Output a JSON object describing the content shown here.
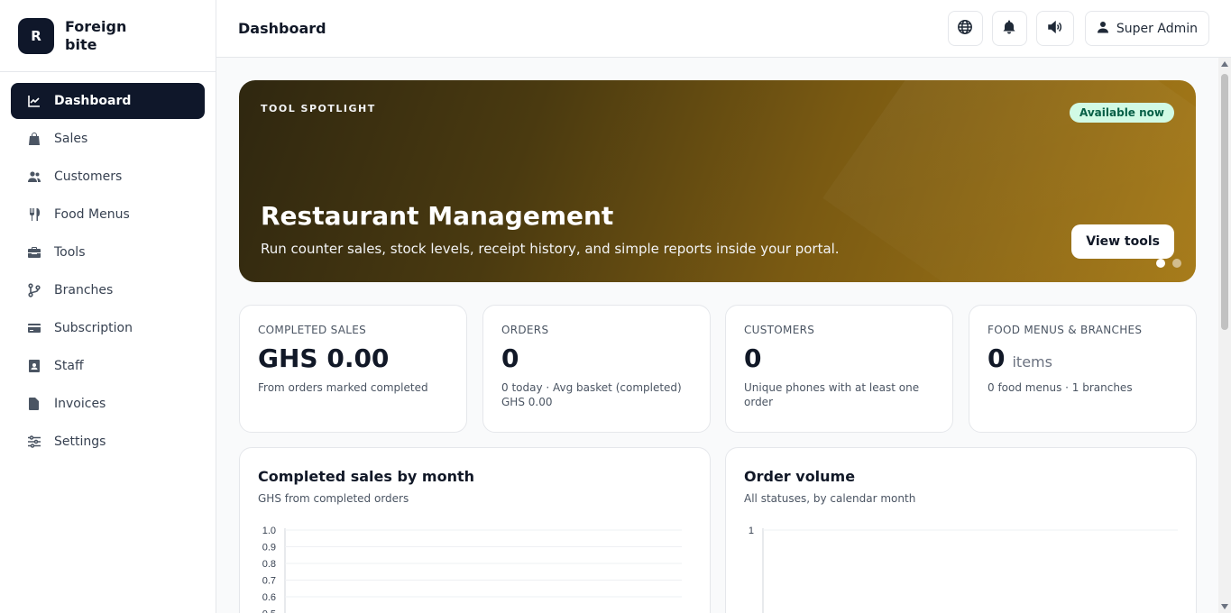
{
  "brand": {
    "logo_letter": "R",
    "name": "Foreign bite"
  },
  "sidebar": {
    "items": [
      {
        "label": "Dashboard",
        "icon": "chart-line-icon",
        "active": true
      },
      {
        "label": "Sales",
        "icon": "shopping-bag-icon",
        "active": false
      },
      {
        "label": "Customers",
        "icon": "users-icon",
        "active": false
      },
      {
        "label": "Food Menus",
        "icon": "utensils-icon",
        "active": false
      },
      {
        "label": "Tools",
        "icon": "toolbox-icon",
        "active": false
      },
      {
        "label": "Branches",
        "icon": "code-branch-icon",
        "active": false
      },
      {
        "label": "Subscription",
        "icon": "credit-card-icon",
        "active": false
      },
      {
        "label": "Staff",
        "icon": "id-badge-icon",
        "active": false
      },
      {
        "label": "Invoices",
        "icon": "file-invoice-icon",
        "active": false
      },
      {
        "label": "Settings",
        "icon": "sliders-icon",
        "active": false
      }
    ]
  },
  "header": {
    "title": "Dashboard",
    "icons": [
      "globe-icon",
      "bell-icon",
      "volume-icon"
    ],
    "user_label": "Super Admin"
  },
  "hero": {
    "kicker": "TOOL SPOTLIGHT",
    "badge": "Available now",
    "title": "Restaurant Management",
    "subtitle": "Run counter sales, stock levels, receipt history, and simple reports inside your portal.",
    "button": "View tools",
    "slides": 2,
    "active_slide": 0
  },
  "stats": [
    {
      "label": "COMPLETED SALES",
      "value": "GHS 0.00",
      "unit": "",
      "note": "From orders marked completed"
    },
    {
      "label": "ORDERS",
      "value": "0",
      "unit": "",
      "note": "0 today · Avg basket (completed) GHS 0.00"
    },
    {
      "label": "CUSTOMERS",
      "value": "0",
      "unit": "",
      "note": "Unique phones with at least one order"
    },
    {
      "label": "FOOD MENUS & BRANCHES",
      "value": "0",
      "unit": "items",
      "note": "0 food menus · 1 branches"
    }
  ],
  "charts": {
    "sales": {
      "title": "Completed sales by month",
      "subtitle": "GHS from completed orders"
    },
    "orders": {
      "title": "Order volume",
      "subtitle": "All statuses, by calendar month"
    }
  },
  "chart_data": [
    {
      "type": "line",
      "title": "Completed sales by month",
      "subtitle": "GHS from completed orders",
      "y_ticks": [
        "1.0",
        "0.9",
        "0.8",
        "0.7",
        "0.6",
        "0.5"
      ],
      "ylim": [
        0,
        1.0
      ],
      "grid": true,
      "series": []
    },
    {
      "type": "bar",
      "title": "Order volume",
      "subtitle": "All statuses, by calendar month",
      "y_ticks": [
        "1"
      ],
      "ylim": [
        0,
        1
      ],
      "grid": true,
      "series": []
    }
  ],
  "colors": {
    "primary": "#0f172a",
    "badge_bg": "#d1fae5",
    "badge_text": "#065f46"
  }
}
